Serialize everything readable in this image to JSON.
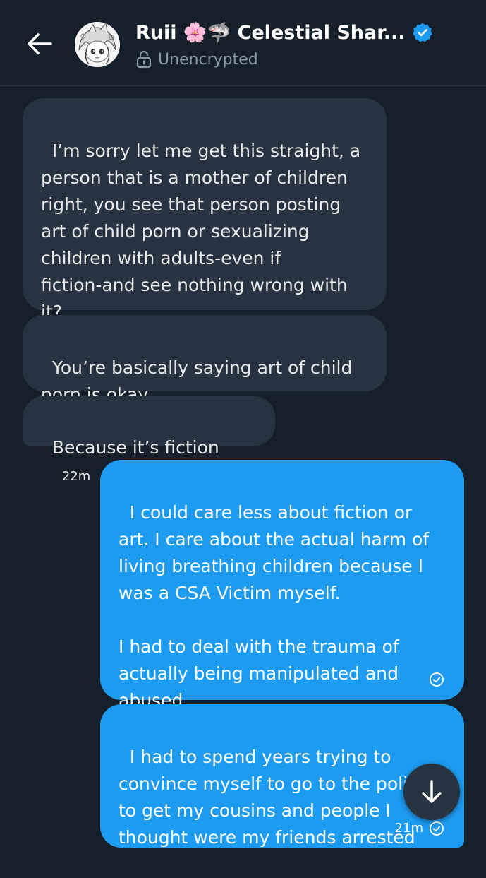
{
  "header": {
    "name": "Ruii 🌸🦈 Celestial Shar...",
    "encryption_status": "Unencrypted"
  },
  "messages": [
    {
      "direction": "incoming",
      "text": "I’m sorry let me get this straight, a\nperson that is a mother of children\nright, you see that person posting\nart of child porn or sexualizing\nchildren with adults-even if\nfiction-and see nothing wrong with\nit?"
    },
    {
      "direction": "incoming",
      "text": "You’re basically saying art of child\nporn is okay"
    },
    {
      "direction": "incoming",
      "text": "Because it’s fiction",
      "time": "22m"
    },
    {
      "direction": "outgoing",
      "text": "I could care less about fiction or\nart. I care about the actual harm of\nliving breathing children because I\nwas a CSA Victim myself.\n\nI had to deal with the trauma of\nactually being manipulated and\nabused.",
      "status": "sent"
    },
    {
      "direction": "outgoing",
      "text": "I had to spend years trying to\nconvince myself to go to the police\nto get my cousins and people I\nthought were my friends arrested",
      "time": "21m",
      "status": "sent"
    }
  ],
  "colors": {
    "background": "#15202b",
    "incoming_bubble": "#273340",
    "outgoing_bubble": "#1d9bf0",
    "verified_badge": "#1d9bf0",
    "muted_text": "#8b98a5"
  },
  "icons": {
    "back": "back-arrow-icon",
    "verified": "verified-badge-icon",
    "lock": "unlocked-padlock-icon",
    "sent": "check-circle-icon",
    "scroll": "arrow-down-icon"
  }
}
